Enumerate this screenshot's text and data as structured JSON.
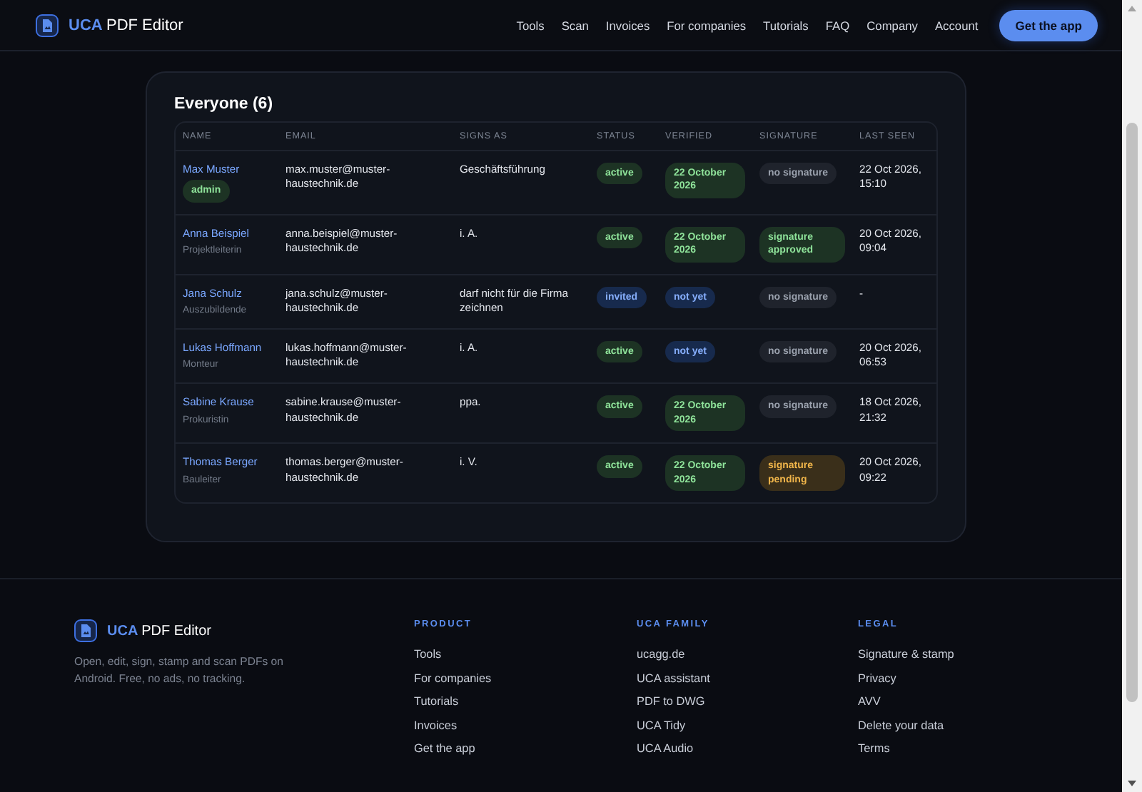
{
  "header": {
    "brand_accent": "UCA",
    "brand_rest": "PDF Editor",
    "nav": [
      "Tools",
      "Scan",
      "Invoices",
      "For companies",
      "Tutorials",
      "FAQ",
      "Company",
      "Account"
    ],
    "cta": "Get the app"
  },
  "members": {
    "title": "Everyone (6)",
    "columns": [
      "NAME",
      "EMAIL",
      "SIGNS AS",
      "STATUS",
      "VERIFIED",
      "SIGNATURE",
      "LAST SEEN"
    ],
    "rows": [
      {
        "name": "Max Muster",
        "tag": "admin",
        "email": "max.muster@muster-haustechnik.de",
        "signs_as": "Geschäftsführung",
        "status": {
          "text": "active",
          "kind": "success"
        },
        "verified": {
          "text": "22 October 2026",
          "kind": "success"
        },
        "signature": {
          "text": "no signature",
          "kind": "muted"
        },
        "last_seen": "22 Oct 2026, 15:10"
      },
      {
        "name": "Anna Beispiel",
        "role": "Projektleiterin",
        "email": "anna.beispiel@muster-haustechnik.de",
        "signs_as": "i. A.",
        "status": {
          "text": "active",
          "kind": "success"
        },
        "verified": {
          "text": "22 October 2026",
          "kind": "success"
        },
        "signature": {
          "text": "signature approved",
          "kind": "success"
        },
        "last_seen": "20 Oct 2026, 09:04"
      },
      {
        "name": "Jana Schulz",
        "role": "Auszubildende",
        "email": "jana.schulz@muster-haustechnik.de",
        "signs_as": "darf nicht für die Firma zeichnen",
        "status": {
          "text": "invited",
          "kind": "info"
        },
        "verified": {
          "text": "not yet",
          "kind": "info"
        },
        "signature": {
          "text": "no signature",
          "kind": "muted"
        },
        "last_seen": "-"
      },
      {
        "name": "Lukas Hoffmann",
        "role": "Monteur",
        "email": "lukas.hoffmann@muster-haustechnik.de",
        "signs_as": "i. A.",
        "status": {
          "text": "active",
          "kind": "success"
        },
        "verified": {
          "text": "not yet",
          "kind": "info"
        },
        "signature": {
          "text": "no signature",
          "kind": "muted"
        },
        "last_seen": "20 Oct 2026, 06:53"
      },
      {
        "name": "Sabine Krause",
        "role": "Prokuristin",
        "email": "sabine.krause@muster-haustechnik.de",
        "signs_as": "ppa.",
        "status": {
          "text": "active",
          "kind": "success"
        },
        "verified": {
          "text": "22 October 2026",
          "kind": "success"
        },
        "signature": {
          "text": "no signature",
          "kind": "muted"
        },
        "last_seen": "18 Oct 2026, 21:32"
      },
      {
        "name": "Thomas Berger",
        "role": "Bauleiter",
        "email": "thomas.berger@muster-haustechnik.de",
        "signs_as": "i. V.",
        "status": {
          "text": "active",
          "kind": "success"
        },
        "verified": {
          "text": "22 October 2026",
          "kind": "success"
        },
        "signature": {
          "text": "signature pending",
          "kind": "warning"
        },
        "last_seen": "20 Oct 2026, 09:22"
      }
    ]
  },
  "footer": {
    "brand_accent": "UCA",
    "brand_rest": "PDF Editor",
    "tagline": "Open, edit, sign, stamp and scan PDFs on Android. Free, no ads, no tracking.",
    "columns": [
      {
        "heading": "PRODUCT",
        "links": [
          "Tools",
          "For companies",
          "Tutorials",
          "Invoices",
          "Get the app"
        ]
      },
      {
        "heading": "UCA FAMILY",
        "links": [
          "ucagg.de",
          "UCA assistant",
          "PDF to DWG",
          "UCA Tidy",
          "UCA Audio"
        ]
      },
      {
        "heading": "LEGAL",
        "links": [
          "Signature & stamp",
          "Privacy",
          "AVV",
          "Delete your data",
          "Terms"
        ]
      }
    ]
  }
}
